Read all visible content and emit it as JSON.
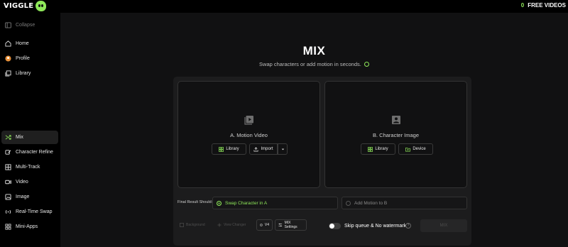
{
  "brand": {
    "name": "VIGGLE"
  },
  "topbar": {
    "free_count": "0",
    "free_label": "FREE VIDEOS"
  },
  "sidebar": {
    "collapse_label": "Collapse",
    "items": [
      {
        "label": "Home",
        "icon": "home-icon"
      },
      {
        "label": "Profile",
        "icon": "profile-avatar-icon"
      },
      {
        "label": "Library",
        "icon": "library-icon"
      },
      {
        "label": "Mix",
        "icon": "shuffle-icon",
        "active": true
      },
      {
        "label": "Character Refine",
        "icon": "wand-icon"
      },
      {
        "label": "Multi-Track",
        "icon": "multi-track-icon"
      },
      {
        "label": "Video",
        "icon": "video-icon"
      },
      {
        "label": "Image",
        "icon": "image-icon"
      },
      {
        "label": "Real-Time Swap",
        "icon": "broadcast-icon"
      },
      {
        "label": "Mini-Apps",
        "icon": "grid-icon"
      }
    ]
  },
  "main": {
    "title": "MIX",
    "subtitle": "Swap characters or add motion in seconds.",
    "motion_card": {
      "label": "A. Motion Video",
      "library_label": "Library",
      "import_label": "Import"
    },
    "character_card": {
      "label": "B. Character Image",
      "library_label": "Library",
      "device_label": "Device"
    },
    "result": {
      "label": "Final Result Should:",
      "option_a": "Swap Character in A",
      "option_b": "Add Motion to B",
      "selected": "Swap Character in A"
    },
    "controls": {
      "background_label": "Background",
      "view_changer_label": "View Changer",
      "model_label": "V4",
      "settings_label": "MIX Settings",
      "skip_label": "Skip queue & No watermark",
      "help_glyph": "?",
      "mix_button_label": "MIX"
    }
  },
  "colors": {
    "accent": "#8fe85a",
    "background": "#111112",
    "panel": "#1c1c1d"
  }
}
